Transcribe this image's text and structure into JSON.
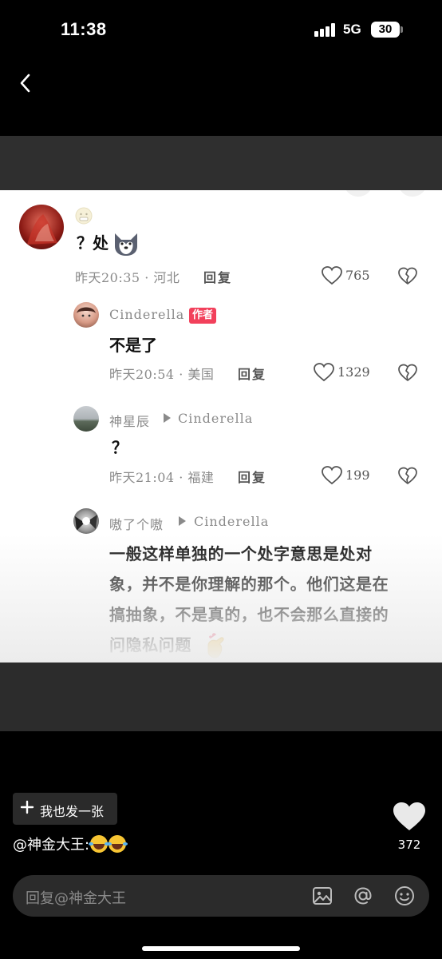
{
  "status_bar": {
    "time": "11:38",
    "network": "5G",
    "battery": "30"
  },
  "comments": [
    {
      "emoji_name": "grimace-face",
      "text": "？处",
      "sticker": "husky-emoji",
      "meta": "昨天20:35 · 河北",
      "reply_label": "回复",
      "likes": "765"
    },
    {
      "username": "Cinderella",
      "badge": "作者",
      "text": "不是了",
      "meta": "昨天20:54 · 美国",
      "reply_label": "回复",
      "likes": "1329"
    },
    {
      "username": "神星辰",
      "reply_to": "Cinderella",
      "text": "？",
      "meta": "昨天21:04 · 福建",
      "reply_label": "回复",
      "likes": "199"
    },
    {
      "username": "嗷了个嗷",
      "reply_to": "Cinderella",
      "text_lines": [
        "一般这样单独的一个处字意思是处对",
        "象，并不是你理解的那个。他们这是在",
        "搞抽象，不是真的，也不会那么直接的",
        "问隐私问题"
      ],
      "sticker": "finger-heart-emoji"
    }
  ],
  "post_button": {
    "label": "我也发一张",
    "icon": "plus-icon"
  },
  "caption": {
    "text": "@神金大王:",
    "emoji": "rofl-emoji"
  },
  "like_total": "372",
  "reply_bar": {
    "placeholder": "回复@神金大王",
    "icons": [
      "image-icon",
      "at-icon",
      "emoji-icon"
    ]
  },
  "colors": {
    "background": "#000000",
    "badge": "#f2405b",
    "panel": "#ffffff",
    "band": "#2f2f2f"
  }
}
